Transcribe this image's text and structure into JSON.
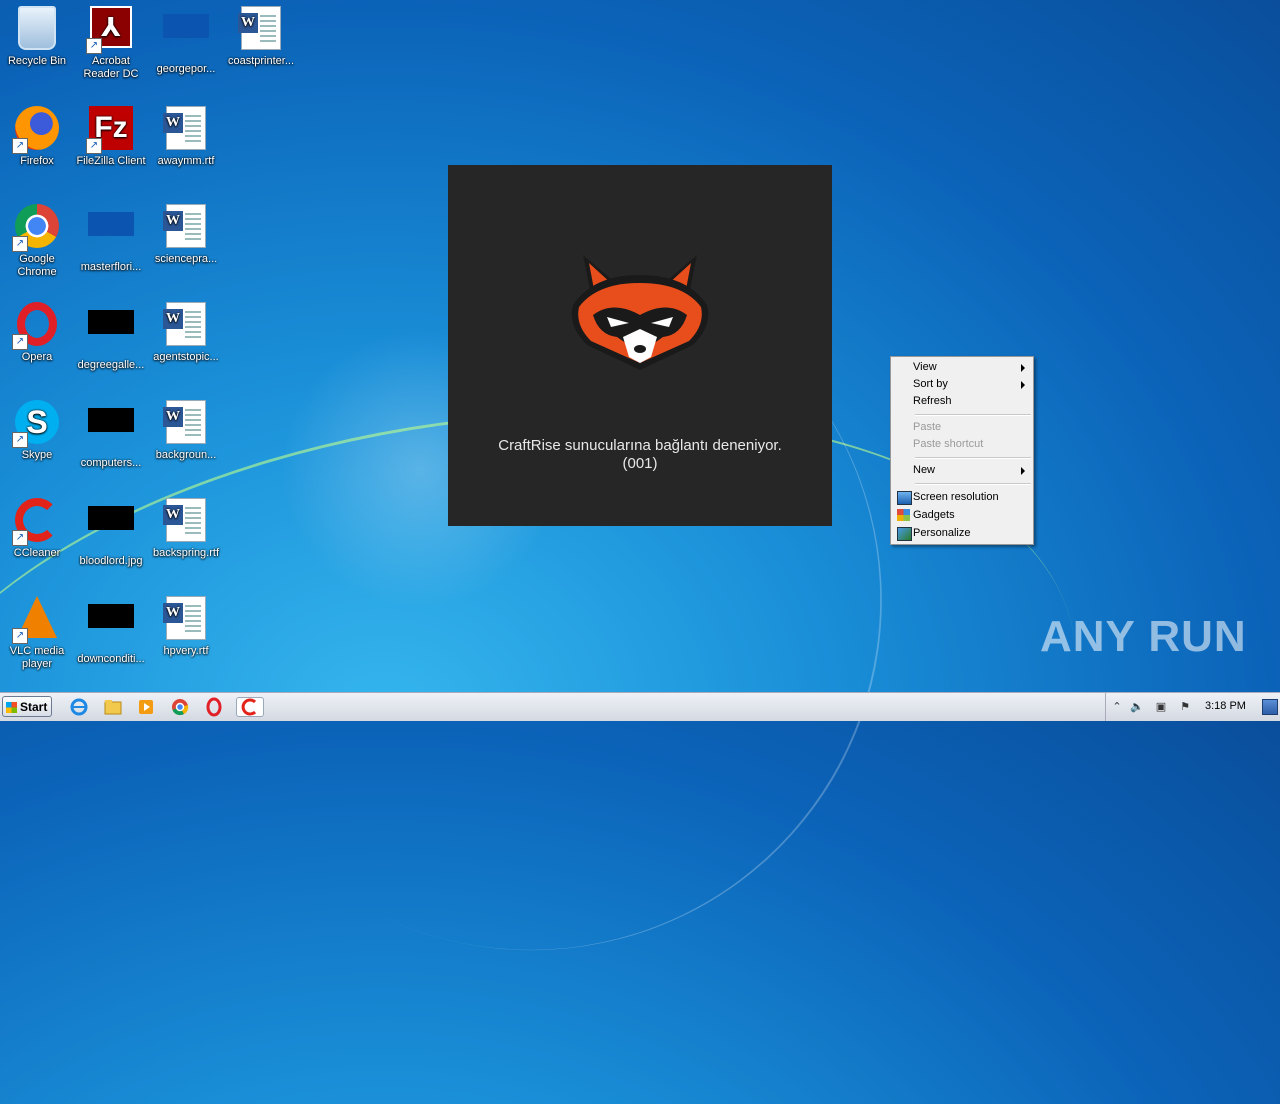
{
  "desktop": {
    "icons": [
      {
        "label": "Recycle Bin"
      },
      {
        "label": "Acrobat Reader DC"
      },
      {
        "label": "georgepor..."
      },
      {
        "label": "coastprinter..."
      },
      {
        "label": "Firefox"
      },
      {
        "label": "FileZilla Client"
      },
      {
        "label": "awaymm.rtf"
      },
      {
        "label": "Google Chrome"
      },
      {
        "label": "masterflori..."
      },
      {
        "label": "sciencepra..."
      },
      {
        "label": "Opera"
      },
      {
        "label": "degreegalle..."
      },
      {
        "label": "agentstopic..."
      },
      {
        "label": "Skype"
      },
      {
        "label": "computers..."
      },
      {
        "label": "backgroun..."
      },
      {
        "label": "CCleaner"
      },
      {
        "label": "bloodlord.jpg"
      },
      {
        "label": "backspring.rtf"
      },
      {
        "label": "VLC media player"
      },
      {
        "label": "downconditi..."
      },
      {
        "label": "hpvery.rtf"
      }
    ]
  },
  "splash": {
    "line1": "CraftRise sunucularına bağlantı deneniyor.",
    "line2": "(001)"
  },
  "context_menu": {
    "view": "View",
    "sort_by": "Sort by",
    "refresh": "Refresh",
    "paste": "Paste",
    "paste_shortcut": "Paste shortcut",
    "new": "New",
    "screen_resolution": "Screen resolution",
    "gadgets": "Gadgets",
    "personalize": "Personalize"
  },
  "watermark": "ANY RUN",
  "taskbar": {
    "start_label": "Start",
    "clock": "3:18 PM"
  }
}
